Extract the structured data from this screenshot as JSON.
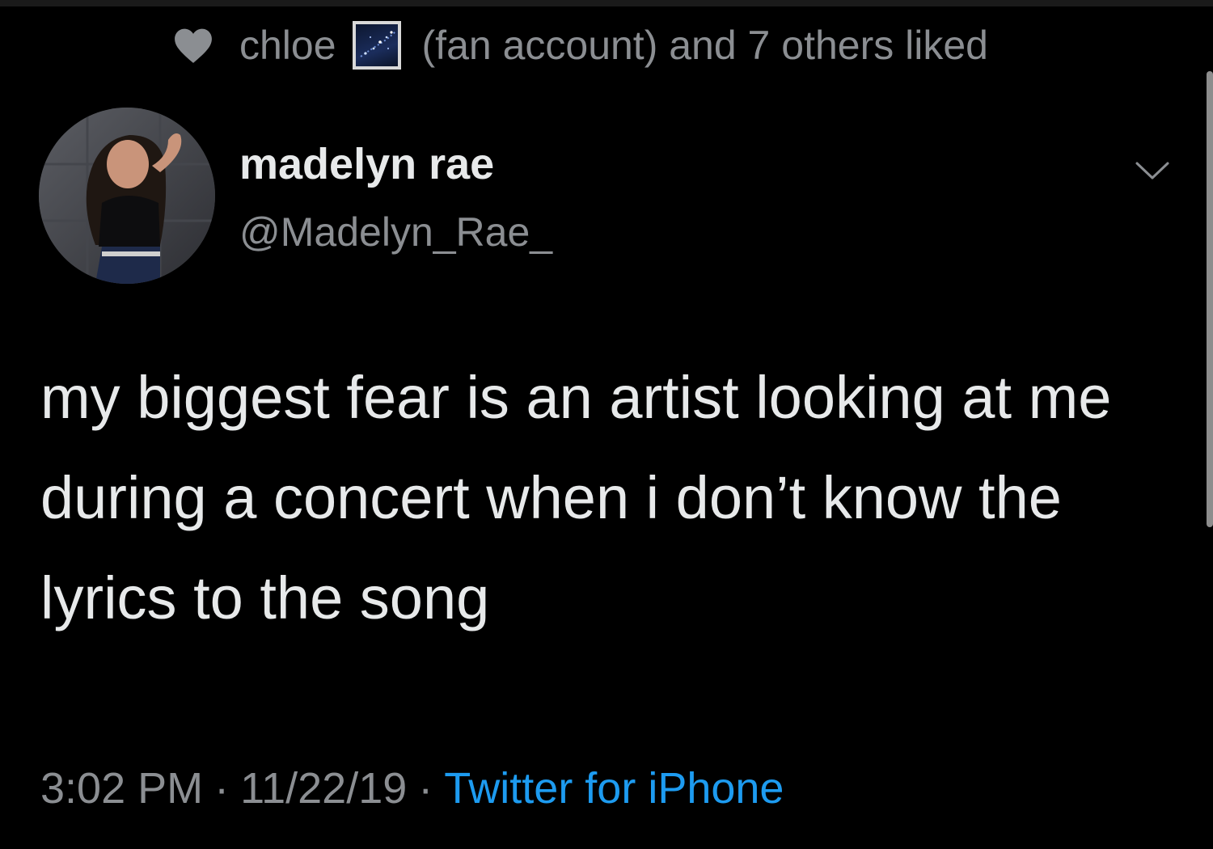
{
  "social_context": {
    "liked_by_name": "chloe",
    "liked_by_suffix": "(fan account) and 7 others liked",
    "heart_icon": "heart-icon",
    "flag_icon": "starry-flag-icon"
  },
  "author": {
    "display_name": "madelyn rae",
    "handle": "@Madelyn_Rae_",
    "avatar": "profile-photo"
  },
  "tweet": {
    "text": "my biggest fear is an artist looking at me during a concert when i don’t know the lyrics to the song"
  },
  "meta": {
    "time": "3:02 PM",
    "separator": "·",
    "date": "11/22/19",
    "source": "Twitter for iPhone"
  },
  "colors": {
    "background": "#000000",
    "primary_text": "#e7e9ea",
    "secondary_text": "#8b8e92",
    "link": "#1d9bf0"
  }
}
